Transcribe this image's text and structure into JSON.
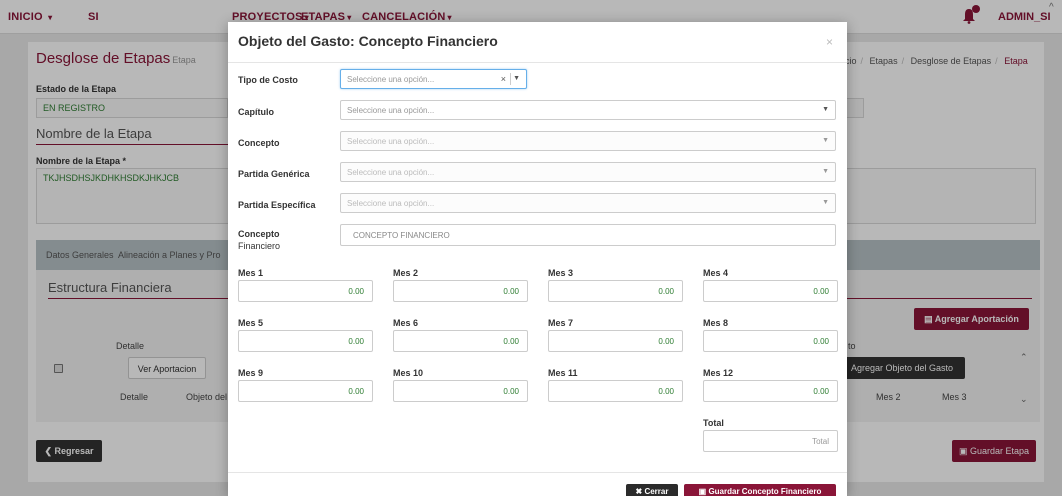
{
  "navbar": {
    "inicio": "INICIO",
    "si": "SI",
    "proyectos": "PROYECTOS",
    "etapas": "ETAPAS",
    "cancelacion": "CANCELACIÓN",
    "admin": "ADMIN_SI"
  },
  "page": {
    "title": "Desglose de Etapas",
    "title_small": "Etapa",
    "breadcrumb": [
      "nicio",
      "Etapas",
      "Desglose de Etapas",
      "Etapa"
    ],
    "estado_label": "Estado de la Etapa",
    "estado_value": "EN REGISTRO",
    "nombre_section": "Nombre de la Etapa",
    "nombre_label": "Nombre de la Etapa *",
    "nombre_value": "TKJHSDHSJKDHKHSDKJHKJCB",
    "tabs": [
      "Datos Generales",
      "Alineación a Planes y Pro"
    ],
    "estructura_title": "Estructura Financiera",
    "agregar_aportacion": "Agregar Aportación",
    "table_header_detalle": "Detalle",
    "table_header_to": "to",
    "ver_aportacion": "Ver Aportacion",
    "agregar_objeto": "Agregar Objeto del Gasto",
    "sub_detalle": "Detalle",
    "sub_objeto": "Objeto del",
    "sub_mes2": "Mes 2",
    "sub_mes3": "Mes 3",
    "regresar": "Regresar",
    "guardar_etapa": "Guardar Etapa"
  },
  "modal": {
    "title": "Objeto del Gasto: Concepto Financiero",
    "close": "×",
    "tipo_costo_label": "Tipo de Costo",
    "tipo_costo_placeholder": "Seleccione una opción...",
    "capitulo_label": "Capítulo",
    "capitulo_placeholder": "Seleccione una opción...",
    "concepto_label": "Concepto",
    "concepto_placeholder": "Seleccione una opción...",
    "partida_generica_label": "Partida Genérica",
    "partida_generica_placeholder": "Seleccione una opción...",
    "partida_especifica_label": "Partida Específica",
    "partida_especifica_placeholder": "Seleccione una opción...",
    "concepto_fin_label_1": "Concepto",
    "concepto_fin_label_2": "Financiero",
    "concepto_fin_placeholder": "CONCEPTO FINANCIERO",
    "meses": [
      {
        "label": "Mes 1",
        "value": "0.00"
      },
      {
        "label": "Mes 2",
        "value": "0.00"
      },
      {
        "label": "Mes 3",
        "value": "0.00"
      },
      {
        "label": "Mes 4",
        "value": "0.00"
      },
      {
        "label": "Mes 5",
        "value": "0.00"
      },
      {
        "label": "Mes 6",
        "value": "0.00"
      },
      {
        "label": "Mes 7",
        "value": "0.00"
      },
      {
        "label": "Mes 8",
        "value": "0.00"
      },
      {
        "label": "Mes 9",
        "value": "0.00"
      },
      {
        "label": "Mes 10",
        "value": "0.00"
      },
      {
        "label": "Mes 11",
        "value": "0.00"
      },
      {
        "label": "Mes 12",
        "value": "0.00"
      }
    ],
    "total_label": "Total",
    "total_placeholder": "Total",
    "cerrar": "Cerrar",
    "guardar": "Guardar Concepto Financiero"
  },
  "colors": {
    "brand": "#8a1538",
    "value_green": "#2e7d32"
  }
}
